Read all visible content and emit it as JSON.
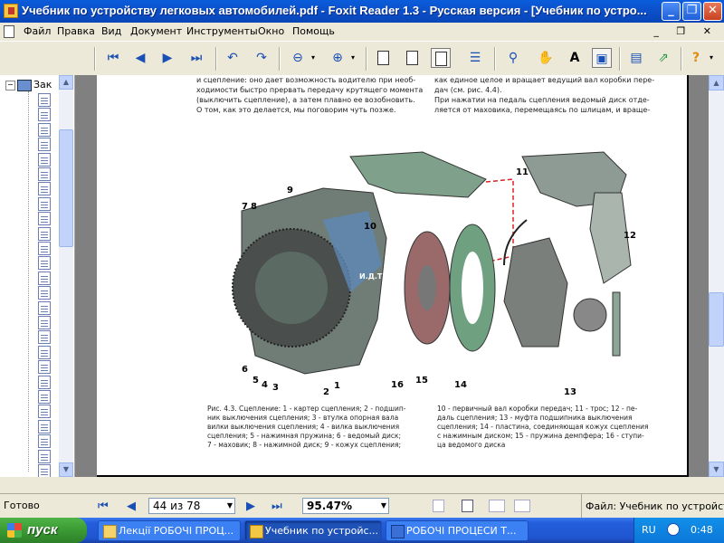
{
  "window": {
    "title": "Учебник по устройству легковых автомобилей.pdf - Foxit Reader 1.3 - Русская версия  - [Учебник по устро...",
    "controls": {
      "minimize": "_",
      "maximize": "❐",
      "close": "✕"
    }
  },
  "menubar": {
    "items": [
      "Файл",
      "Правка",
      "Вид",
      "Документ",
      "Инструменты",
      "Окно",
      "Помощь"
    ],
    "mdi_controls": "_ ❐ ✕"
  },
  "bookmarks": {
    "root_label": "Зак",
    "item_count": 27
  },
  "document": {
    "left_col_top": [
      "и сцепление: оно дает возможность водителю при необ-",
      "ходимости быстро прервать передачу крутящего момента",
      "(выключить сцепление), а затем плавно ее возобновить.",
      "О том, как это делается, мы поговорим чуть позже."
    ],
    "right_col_top": [
      "как единое целое и вращает ведущий вал коробки пере-",
      "дач (см. рис. 4.4).",
      "При нажатии на педаль сцепления ведомый диск отде-",
      "ляется от маховика, перемещаясь по шлицам, и враще-"
    ],
    "figure_callouts": [
      "7",
      "8",
      "9",
      "10",
      "11",
      "12",
      "6",
      "5",
      "4",
      "3",
      "2",
      "1",
      "16",
      "15",
      "14",
      "13"
    ],
    "watermark": "И.Д.Т.Р.",
    "caption_left": [
      "Рис. 4.3. Сцепление: 1 - картер сцепления; 2 - подшип-",
      "ник выключения сцепления; 3 - втулка опорная вала",
      "вилки выключения сцепления; 4 - вилка выключения",
      "сцепления; 5 - нажимная пружина; 6 - ведомый диск;",
      "7 - маховик; 8 - нажимной диск; 9 - кожух сцепления;"
    ],
    "caption_right": [
      "10 - первичный вал коробки передач; 11 - трос; 12 - пе-",
      "даль сцепления; 13 - муфта подшипника выключения",
      "сцепления; 14 - пластина, соединяющая кожух сцепления",
      "с нажимным диском; 15 - пружина демпфера; 16 - ступи-",
      "ца ведомого диска"
    ]
  },
  "navbar": {
    "status": "Готово",
    "page_value": "44 из 78",
    "zoom_value": "95.47%",
    "file_status": "Файл: Учебник по устройству"
  },
  "taskbar": {
    "start_label": "пуск",
    "tasks": [
      {
        "label": "Лекції РОБОЧІ ПРОЦ...",
        "icon": "folder-icon"
      },
      {
        "label": "Учебник по устройс...",
        "icon": "foxit-icon"
      },
      {
        "label": "РОБОЧІ ПРОЦЕСИ Т...",
        "icon": "word-icon"
      }
    ],
    "lang": "RU",
    "clock": "0:48"
  },
  "colors": {
    "titlebar": "#0a5ddb",
    "taskbar": "#245edb",
    "start": "#3a9a33",
    "doc_bg": "#808080"
  }
}
